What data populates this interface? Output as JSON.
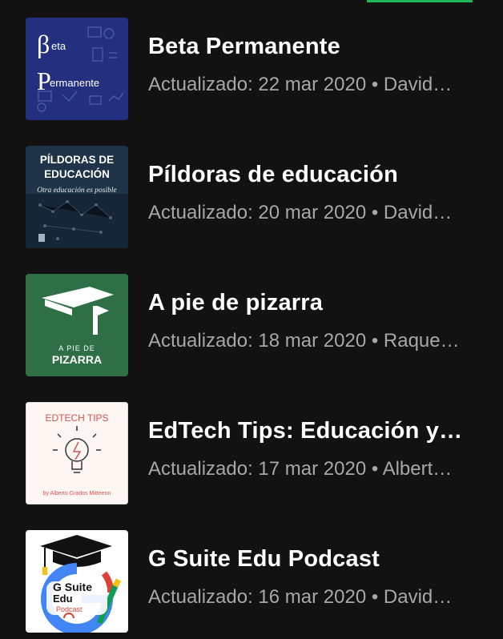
{
  "podcasts": [
    {
      "title": "Beta Permanente",
      "subtitle": "Actualizado: 22 mar 2020 • David…",
      "cover_text": [
        "eta",
        "ermanente"
      ],
      "cover_color": "#2a3686"
    },
    {
      "title": "Píldoras de educación",
      "subtitle": "Actualizado: 20 mar 2020 • David…",
      "cover_text": [
        "PÍLDORAS DE",
        "EDUCACIÓN",
        "Otra educación es posible"
      ],
      "cover_color": "#1f3448"
    },
    {
      "title": "A pie de pizarra",
      "subtitle": "Actualizado: 18 mar 2020 • Raque…",
      "cover_text": [
        "A PIE DE",
        "PIZARRA"
      ],
      "cover_color": "#2f6f46"
    },
    {
      "title": "EdTech Tips: Educación y…",
      "subtitle": "Actualizado: 17 mar 2020 • Albert…",
      "cover_text": [
        "EDTECH TIPS",
        "by Alberto Grados Mitteenn"
      ],
      "cover_color": "#fdf6f2"
    },
    {
      "title": "G Suite Edu Podcast",
      "subtitle": "Actualizado: 16 mar 2020 • David…",
      "cover_text": [
        "G Suite",
        "Edu",
        "Podcast"
      ],
      "cover_color": "#ffffff"
    }
  ]
}
